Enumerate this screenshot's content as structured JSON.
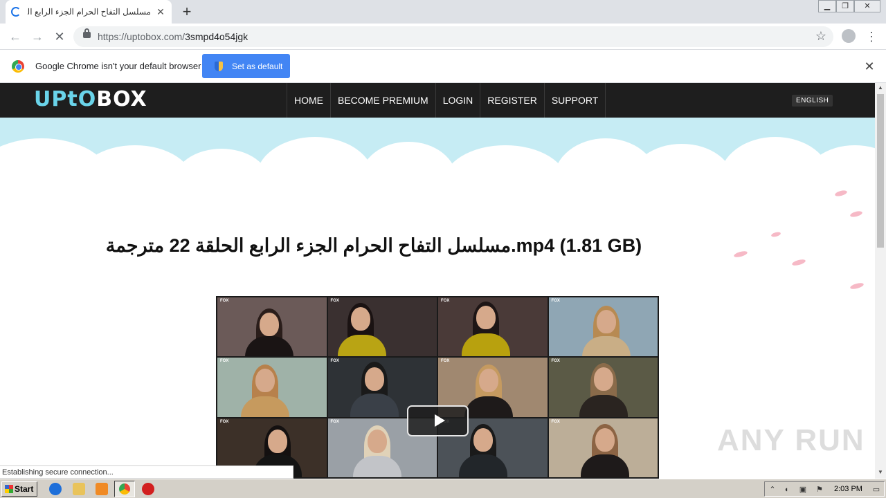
{
  "browser": {
    "tab_title": "مسلسل التفاح الحرام الجزء الرابع الحلقة",
    "url_host": "https://uptobox.com/",
    "url_path": "3smpd4o54jgk"
  },
  "infobar": {
    "message": "Google Chrome isn't your default browser",
    "button_label": "Set as default"
  },
  "site": {
    "logo_part1": "UPtO",
    "logo_part2": "BOX",
    "nav": [
      "HOME",
      "BECOME PREMIUM",
      "LOGIN",
      "REGISTER",
      "SUPPORT"
    ],
    "language": "ENGLISH"
  },
  "content": {
    "file_title": "مسلسل التفاح الحرام الجزء الرابع الحلقة 22 مترجمة.mp4 (1.81 GB)",
    "thumb_logo": "FOX"
  },
  "status": {
    "text": "Establishing secure connection..."
  },
  "watermark": "ANY RUN",
  "taskbar": {
    "start_label": "Start",
    "clock": "2:03 PM"
  }
}
